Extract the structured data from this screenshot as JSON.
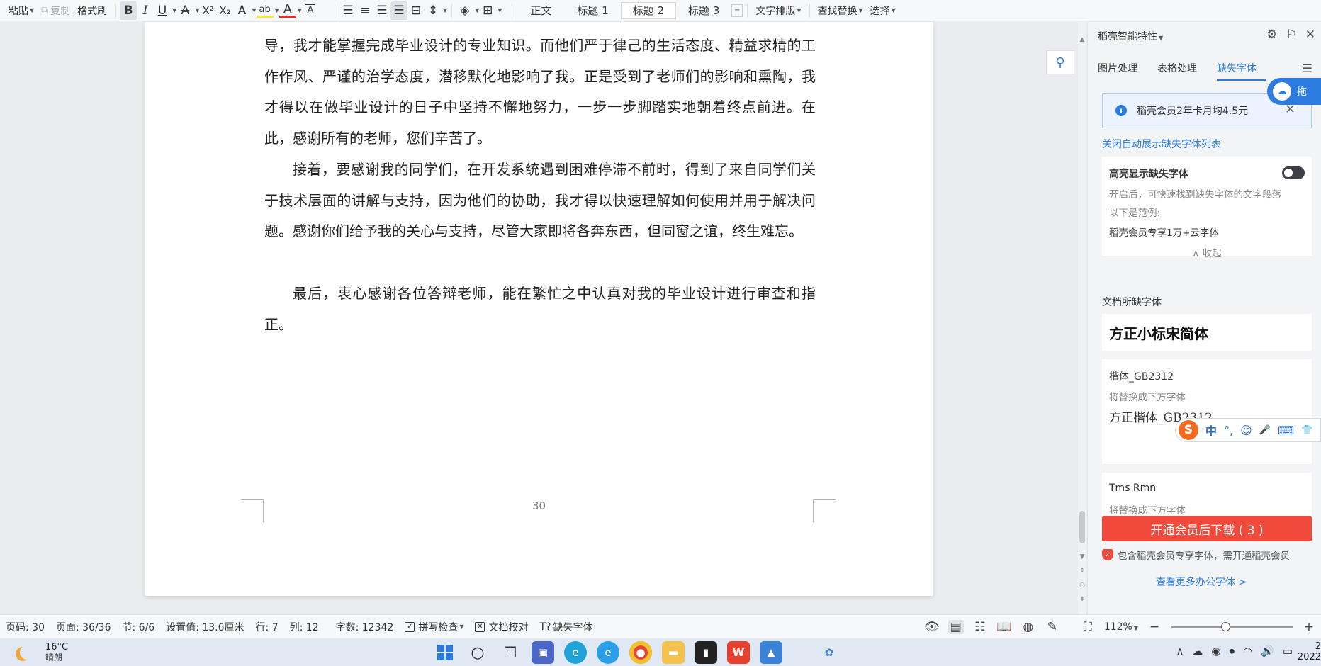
{
  "toolbar": {
    "paste": "粘贴",
    "copy": "复制",
    "format_painter": "格式刷",
    "bold": "B",
    "italic": "I",
    "underline": "U",
    "strike": "A",
    "superscript": "X²",
    "subscript": "X₂",
    "text_effect": "A",
    "highlight": "ab",
    "font_color": "A",
    "char_border": "A",
    "styles": [
      "正文",
      "标题 1",
      "标题 2",
      "标题 3"
    ],
    "text_layout": "文字排版",
    "find_replace": "查找替换",
    "select": "选择"
  },
  "document": {
    "paragraphs": [
      "导，我才能掌握完成毕业设计的专业知识。而他们严于律己的生活态度、精益求精的工作作风、严谨的治学态度，潜移默化地影响了我。正是受到了老师们的影响和熏陶，我才得以在做毕业设计的日子中坚持不懈地努力，一步一步脚踏实地朝着终点前进。在此，感谢所有的老师，您们辛苦了。",
      "接着，要感谢我的同学们，在开发系统遇到困难停滞不前时，得到了来自同学们关于技术层面的讲解与支持，因为他们的协助，我才得以快速理解如何使用并用于解决问题。感谢你们给予我的关心与支持，尽管大家即将各奔东西，但同窗之谊，终生难忘。",
      "最后，衷心感谢各位答辩老师，能在繁忙之中认真对我的毕业设计进行审查和指正。"
    ],
    "page_number": "30"
  },
  "panel": {
    "title": "稻壳智能特性",
    "tabs": [
      "图片处理",
      "表格处理",
      "缺失字体"
    ],
    "active_tab": 2,
    "notice": "稻壳会员2年卡月均4.5元",
    "close_auto_link": "关闭自动展示缺失字体列表",
    "highlight_card": {
      "title": "高亮显示缺失字体",
      "desc": "开启后，可快速找到缺失字体的文字段落",
      "example_label": "以下是范例:",
      "example": "稻壳会员专享1万+云字体",
      "collapse": "收起"
    },
    "missing_label": "文档所缺字体",
    "fonts": [
      {
        "name": "方正小标宋简体"
      },
      {
        "name": "楷体_GB2312",
        "replace_hint": "将替换成下方字体",
        "replacement": "方正楷体_GB2312"
      },
      {
        "name": "Tms Rmn",
        "replace_hint": "将替换成下方字体"
      }
    ],
    "download_button": "开通会员后下载 ( 3 )",
    "member_note": "包含稻壳会员专享字体，需开通稻壳会员",
    "more_fonts_link": "查看更多办公字体 >",
    "cloud_badge_label": "拖"
  },
  "ime": {
    "logo": "S",
    "mode": "中",
    "punct": "°,",
    "emoji": "☺",
    "mic": "🎤",
    "keyboard": "⌨",
    "skin": "👕"
  },
  "statusbar": {
    "page_code": "页码: 30",
    "pages": "页面: 36/36",
    "section": "节: 6/6",
    "setting": "设置值: 13.6厘米",
    "line": "行: 7",
    "column": "列: 12",
    "word_count": "字数: 12342",
    "spell_check": "拼写检查",
    "doc_proof": "文档校对",
    "missing_font": "缺失字体",
    "zoom": "112%",
    "zoom_fraction": 0.45
  },
  "taskbar": {
    "temperature": "16°C",
    "weather": "晴朗",
    "clock_time": "2",
    "clock_date": "2022"
  }
}
